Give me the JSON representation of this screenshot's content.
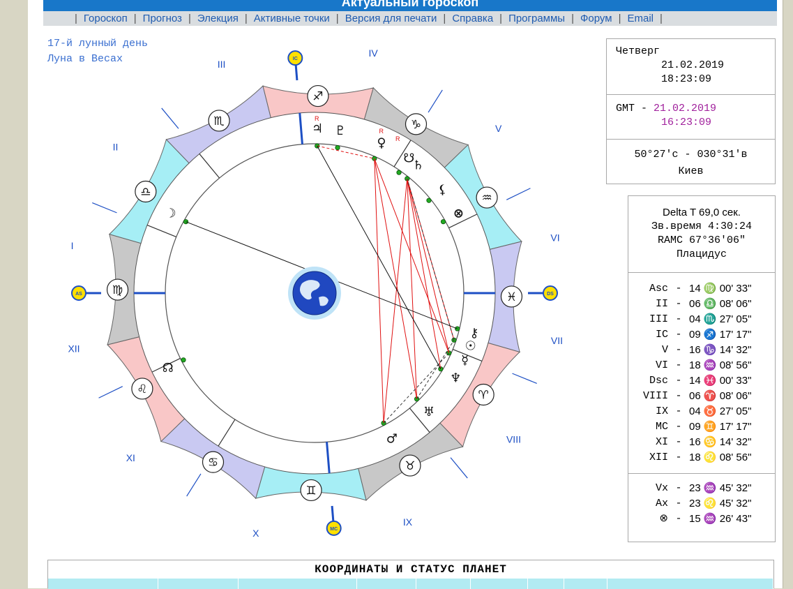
{
  "title": "Актуальный гороскоп",
  "menu": [
    "Гороскоп",
    "Прогноз",
    "Элекция",
    "Активные точки",
    "Версия для печати",
    "Справка",
    "Программы",
    "Форум",
    "Email"
  ],
  "lunar_info": {
    "day": "17-й лунный день",
    "moon_sign": "Луна в Весах"
  },
  "date_box": {
    "weekday": "Четверг",
    "local_date": "21.02.2019",
    "local_time": "18:23:09",
    "gmt_label": "GMT -",
    "gmt_date": "21.02.2019",
    "gmt_time": "16:23:09",
    "coordinates": "50°27'с - 030°31'в",
    "city": "Киев"
  },
  "info_box": {
    "delta_t": "Delta T   69,0 сек.",
    "sidereal": "Зв.время 4:30:24",
    "ramc": "RAMC 67°36'06\"",
    "house_system": "Плацидус",
    "cusps": [
      {
        "name": "Asc",
        "value": "14 ♍ 00' 33\""
      },
      {
        "name": "II",
        "value": "06 ♎ 08' 06\""
      },
      {
        "name": "III",
        "value": "04 ♏ 27' 05\""
      },
      {
        "name": "IC",
        "value": "09 ♐ 17' 17\""
      },
      {
        "name": "V",
        "value": "16 ♑ 14' 32\""
      },
      {
        "name": "VI",
        "value": "18 ♒ 08' 56\""
      },
      {
        "name": "Dsc",
        "value": "14 ♓ 00' 33\""
      },
      {
        "name": "VIII",
        "value": "06 ♈ 08' 06\""
      },
      {
        "name": "IX",
        "value": "04 ♉ 27' 05\""
      },
      {
        "name": "MC",
        "value": "09 ♊ 17' 17\""
      },
      {
        "name": "XI",
        "value": "16 ♋ 14' 32\""
      },
      {
        "name": "XII",
        "value": "18 ♌ 08' 56\""
      }
    ],
    "points": [
      {
        "name": "Vx",
        "value": "23 ♒ 45' 32\""
      },
      {
        "name": "Ax",
        "value": "23 ♌ 45' 32\""
      },
      {
        "name": "⊗",
        "value": "15 ♒ 26' 43\""
      }
    ]
  },
  "chart": {
    "axis_labels": {
      "mc": "MC",
      "ic": "IC",
      "as": "AS",
      "ds": "DS"
    },
    "house_numerals": [
      "I",
      "II",
      "III",
      "IV",
      "V",
      "VI",
      "VII",
      "VIII",
      "IX",
      "X",
      "XI",
      "XII"
    ],
    "zodiac": [
      {
        "glyph": "♈",
        "color": "#f9c7c7"
      },
      {
        "glyph": "♉",
        "color": "#c8c8c8"
      },
      {
        "glyph": "♊",
        "color": "#a6eef5"
      },
      {
        "glyph": "♋",
        "color": "#c9c9f2"
      },
      {
        "glyph": "♌",
        "color": "#f9c7c7"
      },
      {
        "glyph": "♍",
        "color": "#c8c8c8"
      },
      {
        "glyph": "♎",
        "color": "#a6eef5"
      },
      {
        "glyph": "♏",
        "color": "#c9c9f2"
      },
      {
        "glyph": "♐",
        "color": "#f9c7c7"
      },
      {
        "glyph": "♑",
        "color": "#c8c8c8"
      },
      {
        "glyph": "♒",
        "color": "#a6eef5"
      },
      {
        "glyph": "♓",
        "color": "#c9c9f2"
      }
    ],
    "planets": [
      {
        "glyph": "☉",
        "name": "sun"
      },
      {
        "glyph": "☽",
        "name": "moon"
      },
      {
        "glyph": "☿",
        "name": "mercury"
      },
      {
        "glyph": "♀",
        "name": "venus"
      },
      {
        "glyph": "♂",
        "name": "mars"
      },
      {
        "glyph": "♃",
        "name": "jupiter"
      },
      {
        "glyph": "♄",
        "name": "saturn"
      },
      {
        "glyph": "♅",
        "name": "uranus"
      },
      {
        "glyph": "♆",
        "name": "neptune"
      },
      {
        "glyph": "♇",
        "name": "pluto"
      },
      {
        "glyph": "☊",
        "name": "north-node"
      },
      {
        "glyph": "☋",
        "name": "south-node"
      },
      {
        "glyph": "⚷",
        "name": "chiron"
      },
      {
        "glyph": "⚸",
        "name": "lilith"
      },
      {
        "glyph": "⊗",
        "name": "part-of-fortune"
      }
    ],
    "retrograde_mark": "R"
  },
  "coords_table": {
    "title": "КООРДИНАТЫ И СТАТУС ПЛАНЕТ"
  },
  "colors": {
    "accent": "#1877c9",
    "menu_bg": "#d9dde0",
    "gmt_text": "#a0209c",
    "aspect_red": "#e01010",
    "axis_blue": "#1d4fc4"
  }
}
